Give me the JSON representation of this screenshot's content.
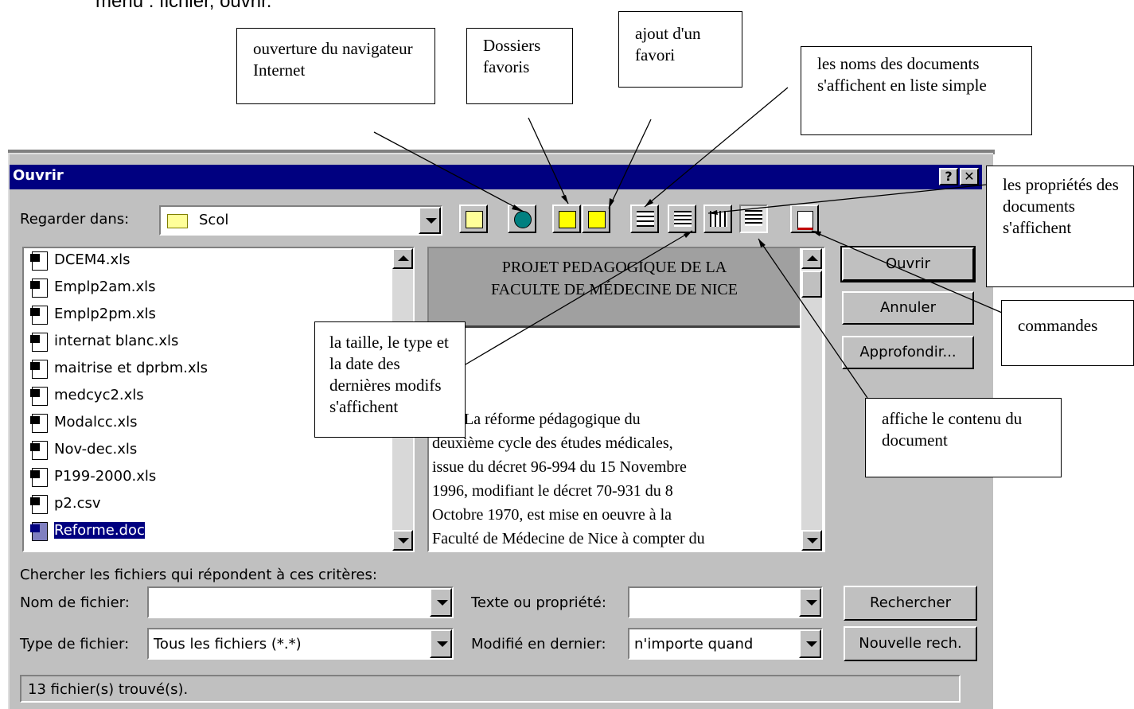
{
  "heading": "menu : fichier, ouvrir.",
  "dialog": {
    "title": "Ouvrir",
    "help_label": "?",
    "close_label": "✕",
    "look_in_label": "Regarder dans:",
    "look_in_value": "Scol",
    "files": [
      {
        "name": "DCEM4.xls",
        "icon": "excel-file-icon"
      },
      {
        "name": "Emplp2am.xls",
        "icon": "excel-file-icon"
      },
      {
        "name": "Emplp2pm.xls",
        "icon": "excel-file-icon"
      },
      {
        "name": "internat blanc.xls",
        "icon": "excel-file-icon"
      },
      {
        "name": "maitrise et dprbm.xls",
        "icon": "excel-file-icon"
      },
      {
        "name": "medcyc2.xls",
        "icon": "excel-file-icon"
      },
      {
        "name": "Modalcc.xls",
        "icon": "excel-file-icon"
      },
      {
        "name": "Nov-dec.xls",
        "icon": "excel-file-icon"
      },
      {
        "name": "P199-2000.xls",
        "icon": "excel-file-icon"
      },
      {
        "name": "p2.csv",
        "icon": "csv-file-icon"
      },
      {
        "name": "Reforme.doc",
        "icon": "word-file-icon",
        "selected": true
      }
    ],
    "preview_title_line1": "PROJET PEDAGOGIQUE DE LA",
    "preview_title_line2": "FACULTE DE MÉDECINE DE NICE",
    "preview_lines": [
      "        La réforme pédagogique du",
      "deuxième cycle des études médicales,",
      "issue du décret 96-994 du 15 Novembre",
      "1996, modifiant le décret 70-931 du 8",
      "Octobre 1970, est mise en oeuvre à la",
      "Faculté de Médecine de Nice à compter du"
    ],
    "buttons": {
      "open": "Ouvrir",
      "cancel": "Annuler",
      "advanced": "Approfondir...",
      "search": "Rechercher",
      "new_search": "Nouvelle rech."
    },
    "criteria_label": "Chercher les fichiers qui répondent à ces critères:",
    "filename_label": "Nom de fichier:",
    "filename_value": "",
    "filetype_label": "Type de fichier:",
    "filetype_value": "Tous les fichiers (*.*)",
    "text_prop_label": "Texte ou propriété:",
    "text_prop_value": "",
    "modified_label": "Modifié en dernier:",
    "modified_value": "n'importe quand",
    "status": "13 fichier(s) trouvé(s)."
  },
  "annotations": {
    "browser": "ouverture du navigateur Internet",
    "favorites": "Dossiers favoris",
    "add_favorite": "ajout d'un favori",
    "list": "les noms des documents s'affichent en liste simple",
    "properties": "les propriétés des documents s'affichent",
    "commands": "commandes",
    "details": "la taille, le type et la date des dernières modifs s'affichent",
    "preview": "affiche le contenu du document"
  }
}
